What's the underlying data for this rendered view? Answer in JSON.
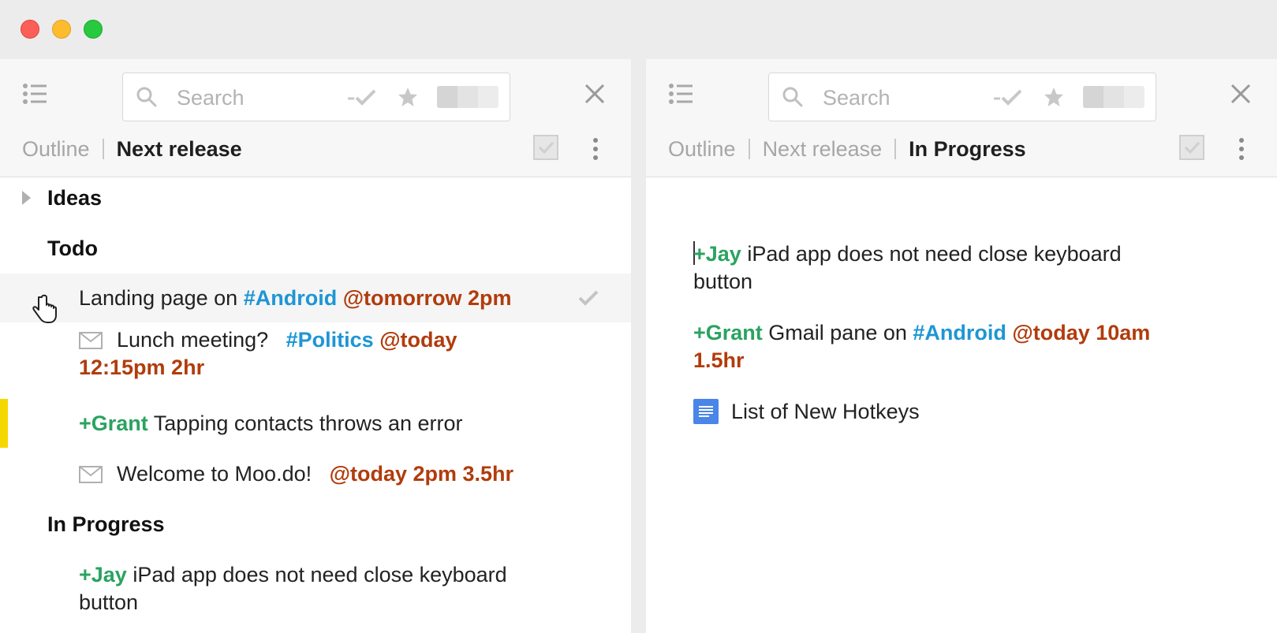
{
  "window": {
    "controls": [
      "close",
      "minimize",
      "maximize"
    ]
  },
  "colors": {
    "tag": "#1e96d4",
    "date": "#b13c0c",
    "person": "#2aa360",
    "highlight_marker": "#f5d800",
    "doc_icon": "#4a86e8"
  },
  "left_pane": {
    "search_placeholder": "Search",
    "breadcrumb": {
      "root": "Outline",
      "current": "Next release"
    },
    "sections": {
      "ideas": "Ideas",
      "todo": "Todo",
      "in_progress": "In Progress"
    },
    "items": {
      "landing": {
        "text": "Landing page on ",
        "tag": "#Android",
        "date": "@tomorrow 2pm",
        "icon": "hand-pointer-icon"
      },
      "lunch": {
        "text": "Lunch meeting? ",
        "tag": "#Politics",
        "date_1": "@today",
        "date_2": "12:15pm 2hr",
        "icon": "mail-icon"
      },
      "tapping": {
        "person": "+Grant",
        "text": " Tapping contacts throws an error"
      },
      "welcome": {
        "text": "Welcome to Moo.do! ",
        "date": "@today 2pm 3.5hr",
        "icon": "mail-icon"
      },
      "ipad": {
        "person": "+Jay",
        "text_1": " iPad app does not need close keyboard",
        "text_2": "button"
      }
    }
  },
  "right_pane": {
    "search_placeholder": "Search",
    "breadcrumb": {
      "root": "Outline",
      "middle": "Next release",
      "current": "In Progress"
    },
    "items": {
      "ipad": {
        "person": "+Jay",
        "text_1": " iPad app does not need close keyboard",
        "text_2": "button"
      },
      "gmail": {
        "person": "+Grant",
        "text": " Gmail pane on ",
        "tag": "#Android",
        "date_1": "@today 10am",
        "date_2": "1.5hr"
      },
      "hotkeys": {
        "text": "List of New Hotkeys",
        "icon": "google-doc-icon"
      }
    }
  }
}
